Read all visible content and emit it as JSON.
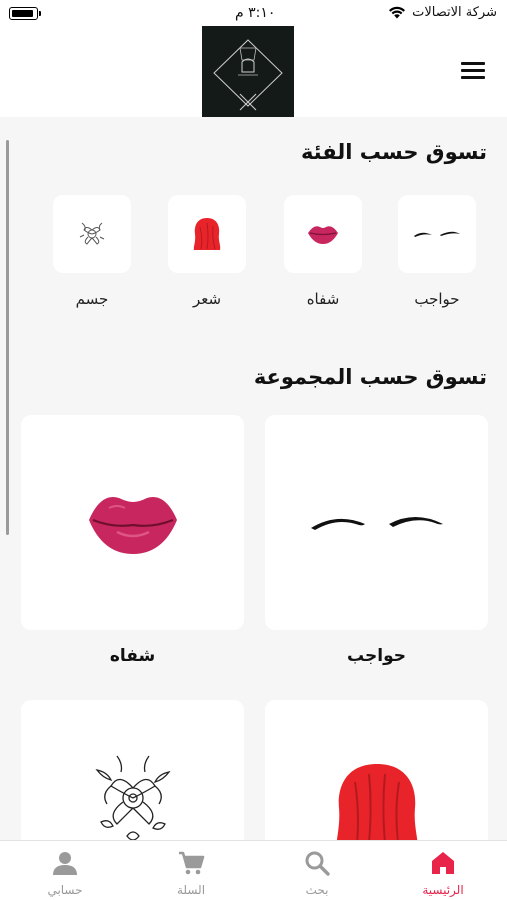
{
  "status_bar": {
    "carrier": "شركة الاتصالات",
    "time": "٣:١٠ م",
    "battery_level": 0.95
  },
  "header": {
    "logo_icon": "brand-logo",
    "menu_icon": "hamburger-menu-icon"
  },
  "shop_by_category": {
    "title": "تسوق حسب الفئة",
    "items": [
      {
        "label": "حواجب",
        "icon": "eyebrows-icon"
      },
      {
        "label": "شفاه",
        "icon": "lips-icon"
      },
      {
        "label": "شعر",
        "icon": "hair-icon"
      },
      {
        "label": "جسم",
        "icon": "flower-tattoo-icon"
      }
    ]
  },
  "shop_by_collection": {
    "title": "تسوق حسب المجموعة",
    "items": [
      {
        "label": "حواجب",
        "image": "eyebrows-image"
      },
      {
        "label": "شفاه",
        "image": "lips-image"
      },
      {
        "label": "",
        "image": "hair-image"
      },
      {
        "label": "",
        "image": "flower-tattoo-image"
      }
    ]
  },
  "bottom_nav": {
    "items": [
      {
        "label": "الرئيسية",
        "icon": "home-icon",
        "active": true
      },
      {
        "label": "بحث",
        "icon": "search-icon",
        "active": false
      },
      {
        "label": "السلة",
        "icon": "cart-icon",
        "active": false
      },
      {
        "label": "حسابي",
        "icon": "account-icon",
        "active": false
      }
    ]
  },
  "colors": {
    "accent": "#e8244b",
    "lips": "#c8265e",
    "hair": "#e8242a",
    "inactive": "#9a9a9a"
  }
}
